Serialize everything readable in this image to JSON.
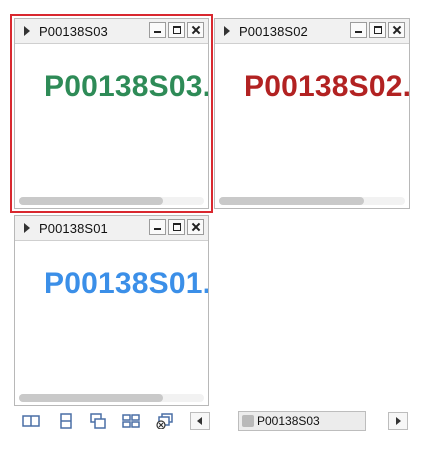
{
  "windows": [
    {
      "id": "s03",
      "title": "P00138S03",
      "content": "P00138S03.",
      "color": "#2e8b57",
      "active": true
    },
    {
      "id": "s02",
      "title": "P00138S02",
      "content": "P00138S02.",
      "color": "#b22222",
      "active": false
    },
    {
      "id": "s01",
      "title": "P00138S01",
      "content": "P00138S01.",
      "color": "#3b8fe8",
      "active": false
    }
  ],
  "window_controls": [
    "minimize-icon",
    "maximize-icon",
    "close-icon"
  ],
  "taskbar": {
    "icons": [
      "tile-vertical-icon",
      "tile-horizontal-icon",
      "cascade-icon",
      "tile-grid-icon",
      "close-all-icon"
    ],
    "active_tab": "P00138S03"
  }
}
